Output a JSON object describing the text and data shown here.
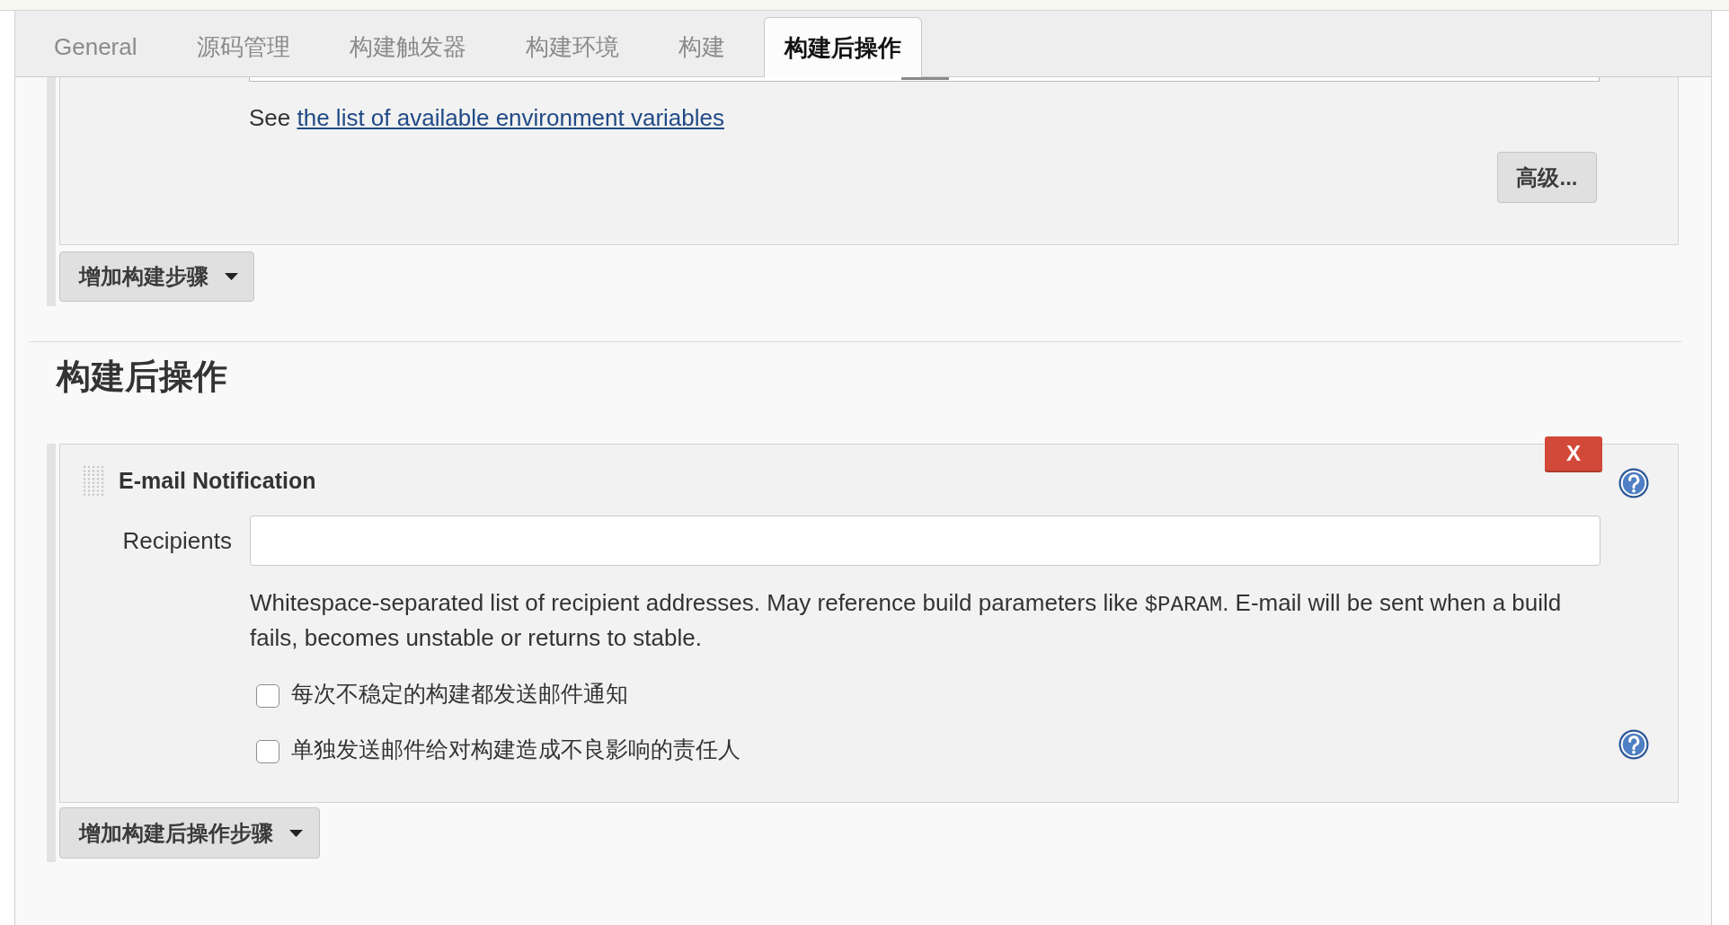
{
  "tabs": [
    {
      "label": "General",
      "selected": false
    },
    {
      "label": "源码管理",
      "selected": false
    },
    {
      "label": "构建触发器",
      "selected": false
    },
    {
      "label": "构建环境",
      "selected": false
    },
    {
      "label": "构建",
      "selected": false
    },
    {
      "label": "构建后操作",
      "selected": true
    }
  ],
  "build_section": {
    "env_note": {
      "text": "See",
      "link": "the list of available environment variables"
    },
    "advanced_button": "高级...",
    "add_step_button": "增加构建步骤"
  },
  "post_build_section": {
    "title": "构建后操作",
    "email_notification": {
      "delete_button": "X",
      "title": "E-mail Notification",
      "recipients": {
        "label": "Recipients"
      },
      "description": [
        {
          "kind": "text",
          "text": "Whitespace-separated list of recipient addresses. May reference build parameters like "
        },
        {
          "kind": "code",
          "text": "$PARAM"
        },
        {
          "kind": "text",
          "text": ". E-mail will be sent when a build fails, becomes unstable or returns to stable."
        }
      ],
      "options": [
        {
          "label": "每次不稳定的构建都发送邮件通知",
          "checked": false,
          "help": false
        },
        {
          "label": "单独发送邮件给对构建造成不良影响的责任人",
          "checked": false,
          "help": true
        }
      ]
    },
    "add_step_button": "增加构建后操作步骤"
  }
}
